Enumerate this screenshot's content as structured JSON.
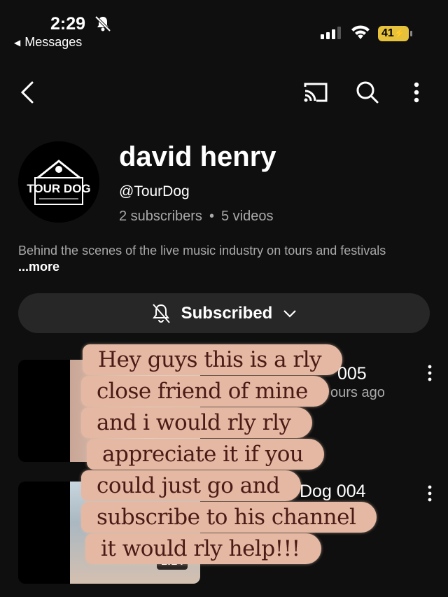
{
  "status_bar": {
    "time": "2:29",
    "back_label": "Messages",
    "battery": "41"
  },
  "channel": {
    "name": "david henry",
    "handle": "@TourDog",
    "subscribers": "2 subscribers",
    "videos": "5 videos",
    "description": "Behind the scenes of the live music industry on tours and festivals",
    "more_label": "...more",
    "avatar_logo_text": "TOUR DOG"
  },
  "subscribe_button": {
    "label": "Subscribed"
  },
  "videos": [
    {
      "title_fragment": "005",
      "meta_fragment": "ours ago"
    },
    {
      "title_fragment": "Dog 004",
      "duration": "1:14"
    }
  ],
  "overlay_caption": [
    "Hey guys this is a rly",
    "close friend of mine",
    "and i would rly rly",
    "appreciate it if you",
    "could just go and",
    "subscribe to his channel",
    "it would rly help!!!"
  ],
  "colors": {
    "background": "#0f0f0f",
    "button_bg": "#272727",
    "battery": "#e6c13b",
    "caption_bg": "#e4b8a2",
    "caption_text": "#4a1a16"
  }
}
